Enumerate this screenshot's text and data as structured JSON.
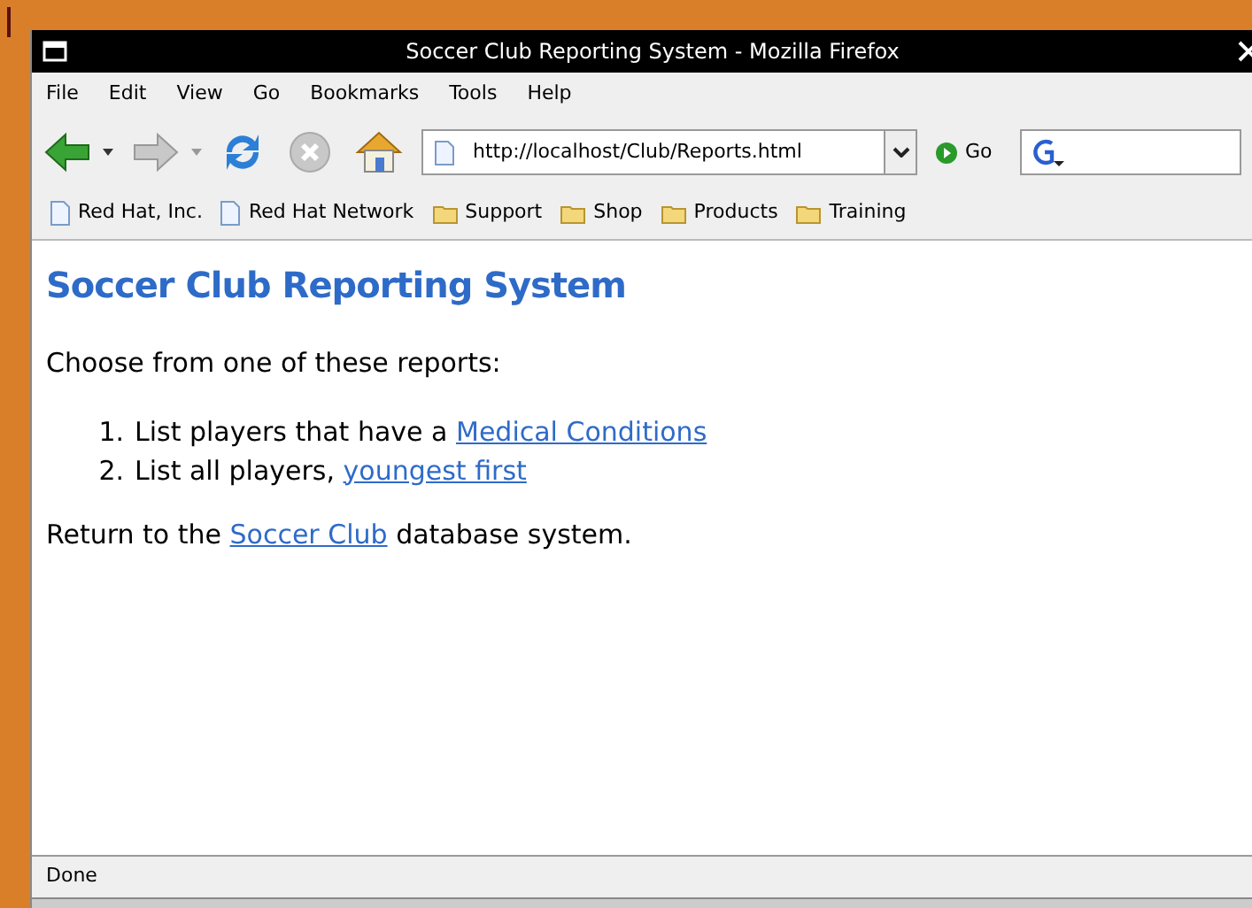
{
  "window": {
    "title": "Soccer Club Reporting System - Mozilla Firefox"
  },
  "menu": [
    "File",
    "Edit",
    "View",
    "Go",
    "Bookmarks",
    "Tools",
    "Help"
  ],
  "toolbar": {
    "url": "http://localhost/Club/Reports.html",
    "go_label": "Go"
  },
  "bookmarks": [
    {
      "label": "Red Hat, Inc.",
      "kind": "page"
    },
    {
      "label": "Red Hat Network",
      "kind": "page"
    },
    {
      "label": "Support",
      "kind": "folder"
    },
    {
      "label": "Shop",
      "kind": "folder"
    },
    {
      "label": "Products",
      "kind": "folder"
    },
    {
      "label": "Training",
      "kind": "folder"
    }
  ],
  "page": {
    "heading": "Soccer Club Reporting System",
    "intro": "Choose from one of these reports:",
    "reports": [
      {
        "number": "1.",
        "text": "List players that have a ",
        "link": "Medical Conditions"
      },
      {
        "number": "2.",
        "text": "List all players, ",
        "link": "youngest first"
      }
    ],
    "footer": {
      "before": "Return to the ",
      "link": "Soccer Club",
      "after": " database system."
    }
  },
  "status_bar": "Done"
}
